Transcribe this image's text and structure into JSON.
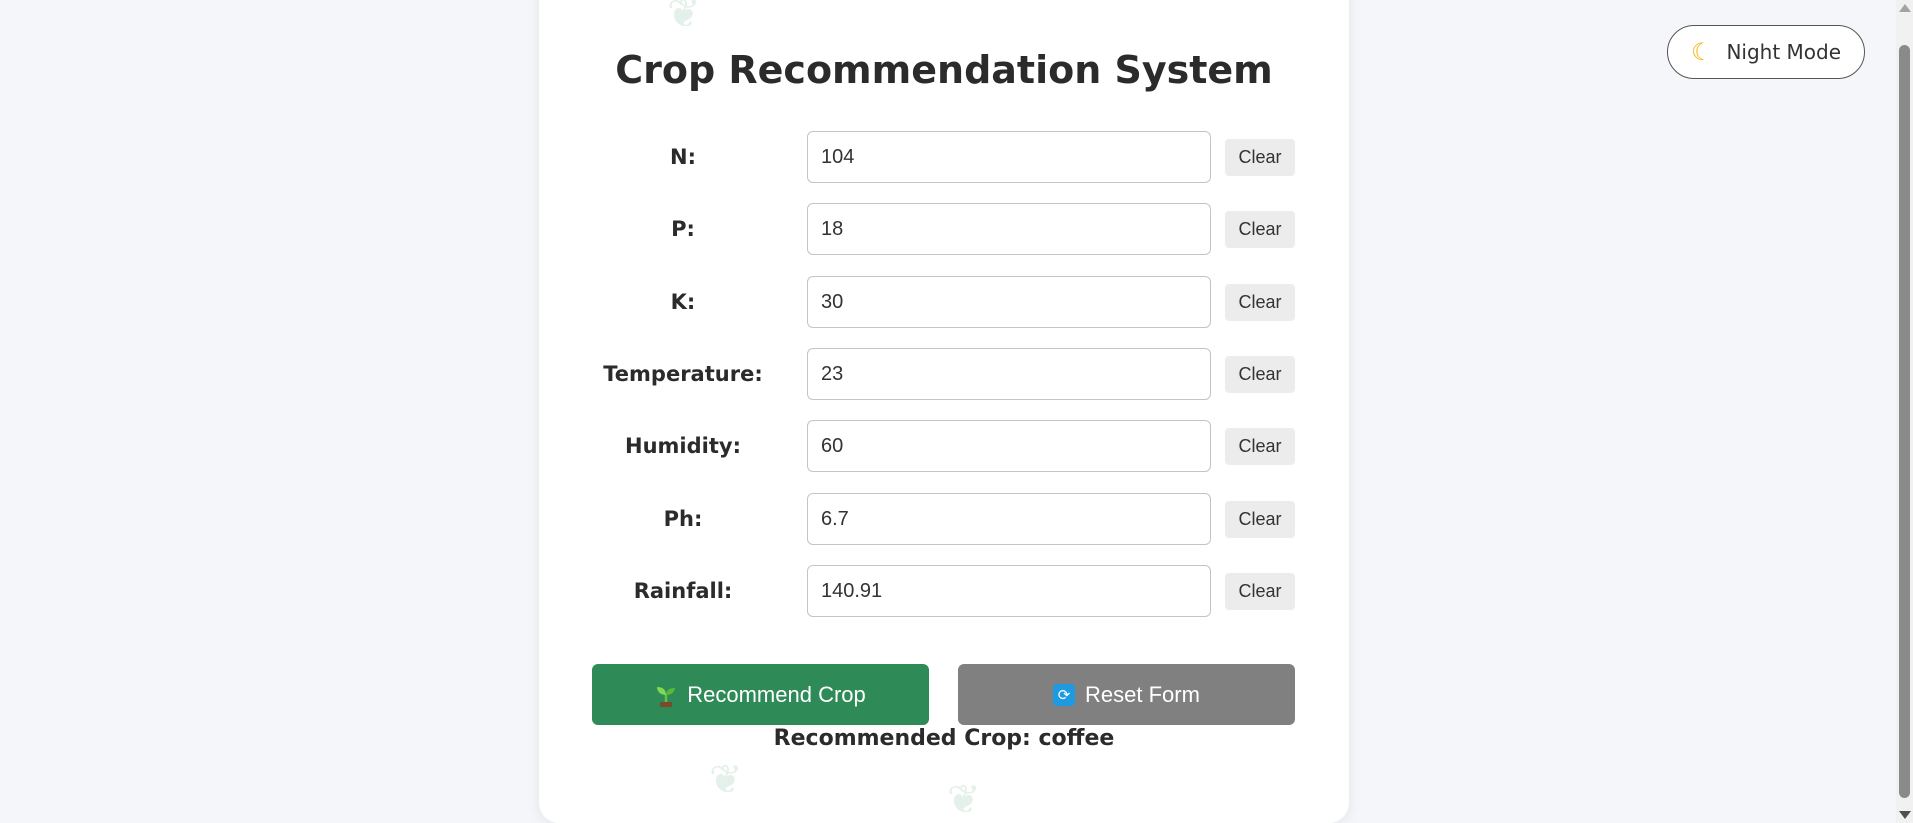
{
  "app": {
    "title": "Crop Recommendation System"
  },
  "night_mode": {
    "icon": "moon-icon",
    "label": "Night Mode"
  },
  "fields": [
    {
      "label": "N:",
      "value": "104",
      "clear_label": "Clear"
    },
    {
      "label": "P:",
      "value": "18",
      "clear_label": "Clear"
    },
    {
      "label": "K:",
      "value": "30",
      "clear_label": "Clear"
    },
    {
      "label": "Temperature:",
      "value": "23",
      "clear_label": "Clear"
    },
    {
      "label": "Humidity:",
      "value": "60",
      "clear_label": "Clear"
    },
    {
      "label": "Ph:",
      "value": "6.7",
      "clear_label": "Clear"
    },
    {
      "label": "Rainfall:",
      "value": "140.91",
      "clear_label": "Clear"
    }
  ],
  "actions": {
    "recommend_label": "Recommend Crop",
    "recommend_icon": "sprout-icon",
    "reset_label": "Reset Form",
    "reset_icon": "refresh-icon"
  },
  "result": {
    "text": "Recommended Crop: coffee"
  },
  "colors": {
    "primary_green": "#2e8b57",
    "reset_gray": "#808080",
    "background": "#f4f6f9"
  }
}
